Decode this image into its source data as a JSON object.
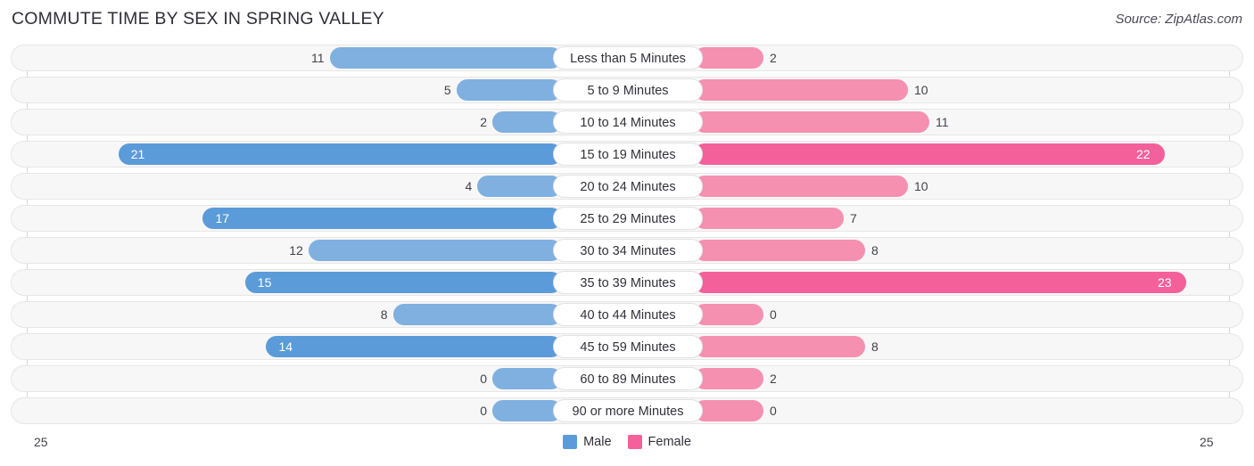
{
  "header": {
    "title": "COMMUTE TIME BY SEX IN SPRING VALLEY",
    "source": "Source: ZipAtlas.com"
  },
  "legend": {
    "items": [
      {
        "label": "Male",
        "color": "#5b9bd9",
        "icon": "male-swatch"
      },
      {
        "label": "Female",
        "color": "#f4609a",
        "icon": "female-swatch"
      }
    ]
  },
  "axis": {
    "left_tick": "25",
    "right_tick": "25",
    "max": 25
  },
  "chart_data": {
    "type": "bar",
    "subtype": "diverging-bidirectional-bar",
    "title": "COMMUTE TIME BY SEX IN SPRING VALLEY",
    "xlabel": "",
    "ylabel": "",
    "xlim": [
      25,
      25
    ],
    "grid": false,
    "legend_position": "bottom-center",
    "categories": [
      "Less than 5 Minutes",
      "5 to 9 Minutes",
      "10 to 14 Minutes",
      "15 to 19 Minutes",
      "20 to 24 Minutes",
      "25 to 29 Minutes",
      "30 to 34 Minutes",
      "35 to 39 Minutes",
      "40 to 44 Minutes",
      "45 to 59 Minutes",
      "60 to 89 Minutes",
      "90 or more Minutes"
    ],
    "series": [
      {
        "name": "Male",
        "direction": "left",
        "values": [
          11,
          5,
          2,
          21,
          4,
          17,
          12,
          15,
          8,
          14,
          0,
          0
        ]
      },
      {
        "name": "Female",
        "direction": "right",
        "values": [
          2,
          10,
          11,
          22,
          10,
          7,
          8,
          23,
          0,
          8,
          2,
          0
        ]
      }
    ]
  },
  "rows": [
    {
      "category": "Less than 5 Minutes",
      "male": "11",
      "female": "2",
      "male_v": 11,
      "female_v": 2,
      "male_hi": false,
      "female_hi": false
    },
    {
      "category": "5 to 9 Minutes",
      "male": "5",
      "female": "10",
      "male_v": 5,
      "female_v": 10,
      "male_hi": false,
      "female_hi": false
    },
    {
      "category": "10 to 14 Minutes",
      "male": "2",
      "female": "11",
      "male_v": 2,
      "female_v": 11,
      "male_hi": false,
      "female_hi": false
    },
    {
      "category": "15 to 19 Minutes",
      "male": "21",
      "female": "22",
      "male_v": 21,
      "female_v": 22,
      "male_hi": true,
      "female_hi": true
    },
    {
      "category": "20 to 24 Minutes",
      "male": "4",
      "female": "10",
      "male_v": 4,
      "female_v": 10,
      "male_hi": false,
      "female_hi": false
    },
    {
      "category": "25 to 29 Minutes",
      "male": "17",
      "female": "7",
      "male_v": 17,
      "female_v": 7,
      "male_hi": true,
      "female_hi": false
    },
    {
      "category": "30 to 34 Minutes",
      "male": "12",
      "female": "8",
      "male_v": 12,
      "female_v": 8,
      "male_hi": false,
      "female_hi": false
    },
    {
      "category": "35 to 39 Minutes",
      "male": "15",
      "female": "23",
      "male_v": 15,
      "female_v": 23,
      "male_hi": true,
      "female_hi": true
    },
    {
      "category": "40 to 44 Minutes",
      "male": "8",
      "female": "0",
      "male_v": 8,
      "female_v": 0,
      "male_hi": false,
      "female_hi": false
    },
    {
      "category": "45 to 59 Minutes",
      "male": "14",
      "female": "8",
      "male_v": 14,
      "female_v": 8,
      "male_hi": true,
      "female_hi": false
    },
    {
      "category": "60 to 89 Minutes",
      "male": "0",
      "female": "2",
      "male_v": 0,
      "female_v": 2,
      "male_hi": false,
      "female_hi": false
    },
    {
      "category": "90 or more Minutes",
      "male": "0",
      "female": "0",
      "male_v": 0,
      "female_v": 0,
      "male_hi": false,
      "female_hi": false
    }
  ]
}
